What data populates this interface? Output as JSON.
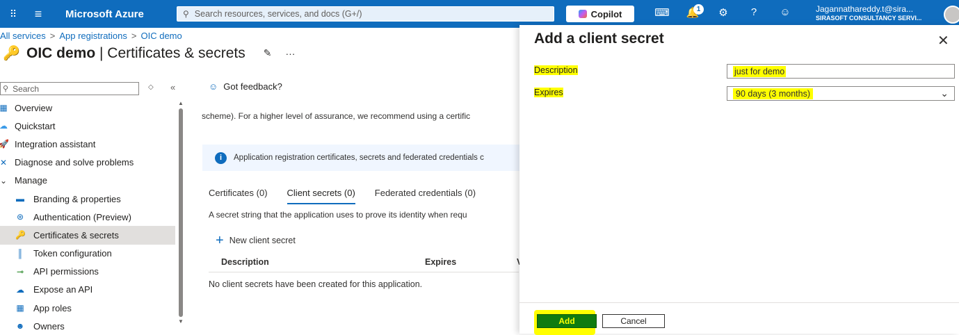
{
  "topbar": {
    "brand": "Microsoft Azure",
    "search_placeholder": "Search resources, services, and docs (G+/)",
    "copilot_label": "Copilot",
    "notification_count": "1",
    "user_email": "Jagannathareddy.t@sira...",
    "user_org": "SIRASOFT CONSULTANCY SERVI..."
  },
  "breadcrumb": [
    "All services",
    "App registrations",
    "OIC demo"
  ],
  "page": {
    "title_bold": "OIC demo",
    "title_rest": " | Certificates & secrets"
  },
  "nav": {
    "search_placeholder": "Search",
    "items": [
      {
        "label": "Overview",
        "icon": "overview-icon"
      },
      {
        "label": "Quickstart",
        "icon": "quickstart-icon"
      },
      {
        "label": "Integration assistant",
        "icon": "rocket-icon"
      },
      {
        "label": "Diagnose and solve problems",
        "icon": "wrench-icon"
      },
      {
        "label": "Manage",
        "icon": "chevron-down-icon"
      },
      {
        "label": "Branding & properties",
        "icon": "branding-icon"
      },
      {
        "label": "Authentication (Preview)",
        "icon": "authentication-icon"
      },
      {
        "label": "Certificates & secrets",
        "icon": "key-icon"
      },
      {
        "label": "Token configuration",
        "icon": "token-icon"
      },
      {
        "label": "API permissions",
        "icon": "api-permissions-icon"
      },
      {
        "label": "Expose an API",
        "icon": "cloud-icon"
      },
      {
        "label": "App roles",
        "icon": "app-roles-icon"
      },
      {
        "label": "Owners",
        "icon": "owners-icon"
      }
    ]
  },
  "main": {
    "feedback": "Got feedback?",
    "scheme_text": "scheme). For a higher level of assurance, we recommend using a certific",
    "info_text": "Application registration certificates, secrets and federated credentials c",
    "tabs": [
      "Certificates (0)",
      "Client secrets (0)",
      "Federated credentials (0)"
    ],
    "secret_description": "A secret string that the application uses to prove its identity when requ",
    "new_secret_label": "New client secret",
    "columns": [
      "Description",
      "Expires",
      "V"
    ],
    "empty_message": "No client secrets have been created for this application."
  },
  "panel": {
    "title": "Add a client secret",
    "description_label": "Description",
    "description_value": "just for demo",
    "expires_label": "Expires",
    "expires_value": "90 days (3 months)",
    "add_label": "Add",
    "cancel_label": "Cancel"
  },
  "colors": {
    "azure_blue": "#0f6cbd",
    "highlight": "#ffff00",
    "add_button": "#107c10"
  }
}
